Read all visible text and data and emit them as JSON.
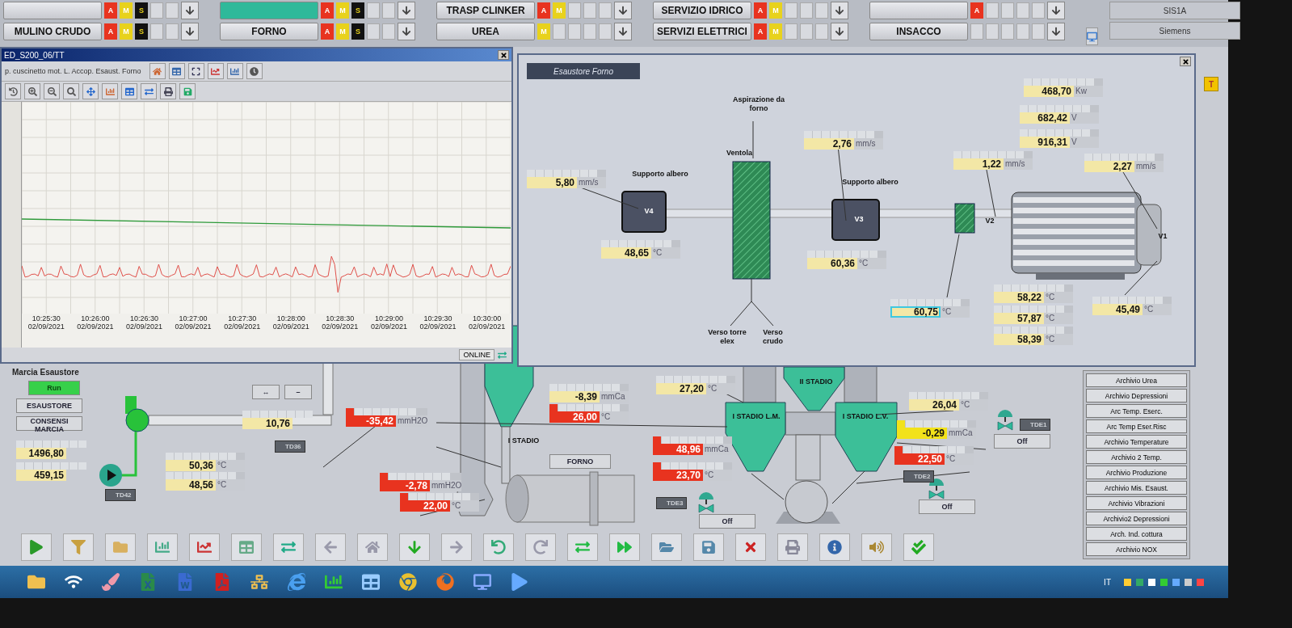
{
  "top_bar": {
    "rows": [
      [
        {
          "indicators": [
            {
              "letter": "A",
              "color": "#e8331f"
            },
            {
              "letter": "M",
              "color": "#e8d21c"
            },
            {
              "letter": "S",
              "color": "#111111"
            }
          ],
          "active": false
        },
        {
          "indicators": [
            {
              "letter": "A",
              "color": "#e8331f"
            },
            {
              "letter": "M",
              "color": "#e8d21c"
            },
            {
              "letter": "S",
              "color": "#111111"
            }
          ],
          "active": true
        },
        {
          "label": "TRASP CLINKER",
          "indicators": [
            {
              "letter": "A",
              "color": "#e8331f"
            },
            {
              "letter": "M",
              "color": "#e8d21c"
            }
          ],
          "active": false
        },
        {
          "label": "SERVIZIO IDRICO",
          "indicators": [
            {
              "letter": "A",
              "color": "#e8331f"
            },
            {
              "letter": "M",
              "color": "#e8d21c"
            }
          ],
          "active": false
        },
        {
          "indicators": [
            {
              "letter": "A",
              "color": "#e8331f"
            }
          ],
          "active": false
        }
      ],
      [
        {
          "label": "MULINO CRUDO",
          "indicators": [
            {
              "letter": "A",
              "color": "#e8331f"
            },
            {
              "letter": "M",
              "color": "#e8d21c"
            },
            {
              "letter": "S",
              "color": "#111111"
            }
          ],
          "active": false
        },
        {
          "label": "FORNO",
          "indicators": [
            {
              "letter": "A",
              "color": "#e8331f"
            },
            {
              "letter": "M",
              "color": "#e8d21c"
            },
            {
              "letter": "S",
              "color": "#111111"
            }
          ],
          "active": false
        },
        {
          "label": "UREA",
          "indicators": [
            {
              "letter": "M",
              "color": "#e8d21c"
            }
          ],
          "active": false
        },
        {
          "label": "SERVIZI ELETTRICI",
          "indicators": [
            {
              "letter": "A",
              "color": "#e8331f"
            },
            {
              "letter": "M",
              "color": "#e8d21c"
            }
          ],
          "active": false
        },
        {
          "label": "INSACCO",
          "active": false
        }
      ]
    ],
    "system": [
      "SIS1A",
      "Siemens"
    ],
    "side_button": "T"
  },
  "trend_window": {
    "title": "ED_S200_06/TT",
    "subtitle": "p. cuscinetto mot. L. Accop. Esaust. Forno",
    "status": "ONLINE",
    "x_labels": [
      {
        "time": "10:25:30",
        "date": "02/09/2021"
      },
      {
        "time": "10:26:00",
        "date": "02/09/2021"
      },
      {
        "time": "10:26:30",
        "date": "02/09/2021"
      },
      {
        "time": "10:27:00",
        "date": "02/09/2021"
      },
      {
        "time": "10:27:30",
        "date": "02/09/2021"
      },
      {
        "time": "10:28:00",
        "date": "02/09/2021"
      },
      {
        "time": "10:28:30",
        "date": "02/09/2021"
      },
      {
        "time": "10:29:00",
        "date": "02/09/2021"
      },
      {
        "time": "10:29:30",
        "date": "02/09/2021"
      },
      {
        "time": "10:30:00",
        "date": "02/09/2021"
      }
    ]
  },
  "fan_window": {
    "title": "Esaustore Forno",
    "labels": [
      "Supporto albero",
      "Aspirazione da forno",
      "Ventola",
      "Supporto albero",
      "Verso torre elex",
      "Verso crudo"
    ],
    "bearings": [
      "V4",
      "V3",
      "V2",
      "V1"
    ],
    "readings": [
      {
        "value": "468,70",
        "unit": "Kw",
        "kind": "normal",
        "focused": false
      },
      {
        "value": "682,42",
        "unit": "V",
        "kind": "normal",
        "focused": false
      },
      {
        "value": "916,31",
        "unit": "V",
        "kind": "normal",
        "focused": false
      },
      {
        "value": "2,76",
        "unit": "mm/s",
        "kind": "normal",
        "focused": false
      },
      {
        "value": "1,22",
        "unit": "mm/s",
        "kind": "normal",
        "focused": false
      },
      {
        "value": "2,27",
        "unit": "mm/s",
        "kind": "normal",
        "focused": false
      },
      {
        "value": "5,80",
        "unit": "mm/s",
        "kind": "normal",
        "focused": false
      },
      {
        "value": "48,65",
        "unit": "°C",
        "kind": "normal",
        "focused": false
      },
      {
        "value": "60,36",
        "unit": "°C",
        "kind": "normal",
        "focused": false
      },
      {
        "value": "60,75",
        "unit": "°C",
        "kind": "normal",
        "focused": true
      },
      {
        "value": "58,22",
        "unit": "°C",
        "kind": "normal",
        "focused": false
      },
      {
        "value": "57,87",
        "unit": "°C",
        "kind": "normal",
        "focused": false
      },
      {
        "value": "58,39",
        "unit": "°C",
        "kind": "normal",
        "focused": false
      },
      {
        "value": "45,49",
        "unit": "°C",
        "kind": "normal",
        "focused": false
      }
    ]
  },
  "process": {
    "title": "Marcia Esaustore",
    "buttons": [
      {
        "label": "Run",
        "kind": "status"
      },
      {
        "label": "ESAUSTORE",
        "kind": "plain"
      },
      {
        "label": "CONSENSI MARCIA",
        "kind": "plain"
      },
      {
        "label": "↔",
        "kind": "plain"
      },
      {
        "label": "–",
        "kind": "plain"
      },
      {
        "label": "FORNO",
        "kind": "plain"
      },
      {
        "label": "Off",
        "kind": "plain"
      },
      {
        "label": "Off",
        "kind": "plain"
      },
      {
        "label": "Off",
        "kind": "plain"
      }
    ],
    "stage_labels": [
      "I STADIO",
      "II STADIO",
      "I STADIO L.M.",
      "I STADIO L.V."
    ],
    "tags": [
      "TD36",
      "TD42",
      "TDE3",
      "TDE2",
      "TDE1"
    ],
    "readings": [
      {
        "value": "1496,80",
        "kind": "normal"
      },
      {
        "value": "459,15",
        "kind": "normal"
      },
      {
        "value": "10,76",
        "kind": "normal"
      },
      {
        "value": "50,36",
        "unit": "°C",
        "kind": "normal"
      },
      {
        "value": "48,56",
        "unit": "°C",
        "kind": "normal"
      },
      {
        "value": "-35,42",
        "unit": "mmH2O",
        "kind": "alarm"
      },
      {
        "value": "-2,78",
        "unit": "mmH2O",
        "kind": "alarm"
      },
      {
        "value": "22,00",
        "unit": "°C",
        "kind": "alarm"
      },
      {
        "value": "-8,39",
        "unit": "mmCa",
        "kind": "normal"
      },
      {
        "value": "26,00",
        "unit": "°C",
        "kind": "alarm"
      },
      {
        "value": "27,20",
        "unit": "°C",
        "kind": "normal"
      },
      {
        "value": "48,96",
        "unit": "mmCa",
        "kind": "alarm"
      },
      {
        "value": "23,70",
        "unit": "°C",
        "kind": "alarm"
      },
      {
        "value": "26,04",
        "unit": "°C",
        "kind": "normal"
      },
      {
        "value": "-0,29",
        "unit": "mmCa",
        "kind": "warning"
      },
      {
        "value": "22,50",
        "unit": "°C",
        "kind": "alarm"
      }
    ]
  },
  "archives": [
    "Archivio Urea",
    "Archivio Depressioni",
    "Arc Temp. Eserc.",
    "Arc Temp Eser.Risc",
    "Archivio Temperature",
    "Archivio 2 Temp.",
    "Archivio Produzione",
    "Archivio Mis. Esaust.",
    "Archivio Vibrazioni",
    "Archivio2 Depressioni",
    "Arch. Ind. cottura",
    "Archivio NOX"
  ],
  "taskbar": {
    "language": "IT"
  }
}
